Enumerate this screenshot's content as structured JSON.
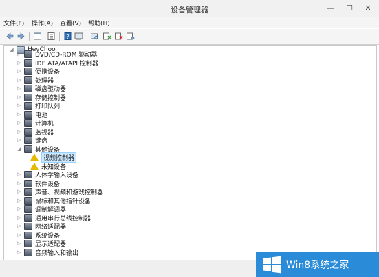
{
  "window": {
    "title": "设备管理器",
    "controls": {
      "minimize": "—",
      "maximize": "☐",
      "close": "✕"
    }
  },
  "menu": [
    "文件(F)",
    "操作(A)",
    "查看(V)",
    "帮助(H)"
  ],
  "toolbar_icons": [
    "back-icon",
    "forward-icon",
    "properties-icon",
    "update-driver-icon",
    "help-icon",
    "show-hidden-icon",
    "scan-hardware-icon",
    "uninstall-icon",
    "disable-icon"
  ],
  "tree": {
    "root": "HeyChoo",
    "items": [
      {
        "label": "DVD/CD-ROM 驱动器"
      },
      {
        "label": "IDE ATA/ATAPI 控制器"
      },
      {
        "label": "便携设备"
      },
      {
        "label": "处理器"
      },
      {
        "label": "磁盘驱动器"
      },
      {
        "label": "存储控制器"
      },
      {
        "label": "打印队列"
      },
      {
        "label": "电池"
      },
      {
        "label": "计算机"
      },
      {
        "label": "监视器"
      },
      {
        "label": "键盘"
      },
      {
        "label": "其他设备"
      },
      {
        "label": "视频控制器"
      },
      {
        "label": "未知设备"
      },
      {
        "label": "人体学输入设备"
      },
      {
        "label": "软件设备"
      },
      {
        "label": "声音、视频和游戏控制器"
      },
      {
        "label": "鼠标和其他指针设备"
      },
      {
        "label": "调制解调器"
      },
      {
        "label": "通用串行总线控制器"
      },
      {
        "label": "网络适配器"
      },
      {
        "label": "系统设备"
      },
      {
        "label": "显示适配器"
      },
      {
        "label": "音频输入和输出"
      }
    ]
  },
  "watermark": {
    "text": "Win8系统之家"
  }
}
